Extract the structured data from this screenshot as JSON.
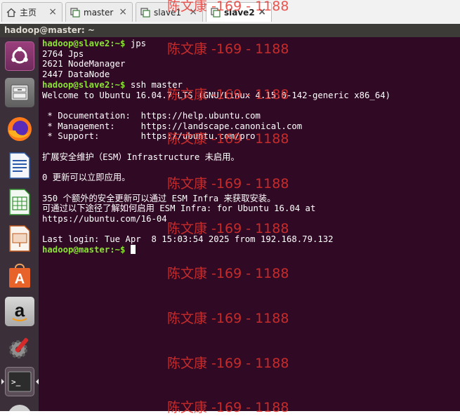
{
  "tabs": [
    {
      "label": "主页",
      "icon": "home-icon",
      "active": false
    },
    {
      "label": "master",
      "icon": "vm-icon",
      "active": false
    },
    {
      "label": "slave1",
      "icon": "vm-icon",
      "active": false
    },
    {
      "label": "slave2",
      "icon": "vm-icon",
      "active": true
    }
  ],
  "tab_close_glyph": "×",
  "window": {
    "title": "hadoop@master: ~"
  },
  "launcher": {
    "items": [
      {
        "name": "ubuntu-dash-icon"
      },
      {
        "name": "file-manager-icon"
      },
      {
        "name": "firefox-icon"
      },
      {
        "name": "libreoffice-writer-icon"
      },
      {
        "name": "libreoffice-calc-icon"
      },
      {
        "name": "libreoffice-impress-icon"
      },
      {
        "name": "software-center-icon"
      },
      {
        "name": "amazon-icon"
      },
      {
        "name": "system-settings-icon"
      },
      {
        "name": "terminal-icon"
      }
    ],
    "amazon_letter": "a",
    "software_letter": "A",
    "terminal_glyph": ">_"
  },
  "terminal": {
    "lines": [
      {
        "prompt": "hadoop@slave2:~$",
        "text": " jps"
      },
      {
        "text": "2764 Jps"
      },
      {
        "text": "2621 NodeManager"
      },
      {
        "text": "2447 DataNode"
      },
      {
        "prompt": "hadoop@slave2:~$",
        "text": " ssh master"
      },
      {
        "text": "Welcome to Ubuntu 16.04.7 LTS (GNU/Linux 4.15.0-142-generic x86_64)"
      },
      {
        "text": ""
      },
      {
        "text": " * Documentation:  https://help.ubuntu.com"
      },
      {
        "text": " * Management:     https://landscape.canonical.com"
      },
      {
        "text": " * Support:        https://ubuntu.com/pro"
      },
      {
        "text": ""
      },
      {
        "text": "扩展安全维护（ESM）Infrastructure 未启用。"
      },
      {
        "text": ""
      },
      {
        "text": "0 更新可以立即应用。"
      },
      {
        "text": ""
      },
      {
        "text": "350 个额外的安全更新可以通过 ESM Infra 来获取安装。"
      },
      {
        "text": "可通过以下途径了解如何启用 ESM Infra: for Ubuntu 16.04 at"
      },
      {
        "text": "https://ubuntu.com/16-04"
      },
      {
        "text": ""
      },
      {
        "text": "Last login: Tue Apr  8 15:03:54 2025 from 192.168.79.132"
      },
      {
        "prompt": "hadoop@master:~$",
        "text": " ",
        "cursor": true
      }
    ]
  },
  "watermark": {
    "text": "陈文康 -169 - 1188",
    "color": "#e8332d",
    "count": 10
  },
  "colors": {
    "terminal_bg": "#300a24",
    "prompt": "#8ae234",
    "launcher_bg": "#3b2f3a",
    "titlebar_bg": "#3c3b37"
  }
}
